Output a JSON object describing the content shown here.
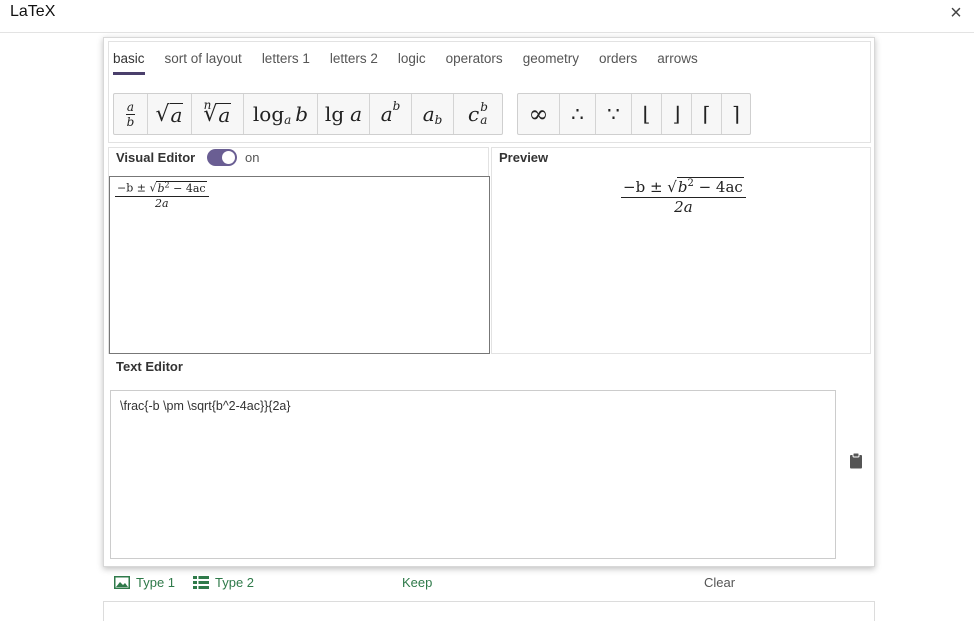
{
  "window": {
    "title": "LaTeX",
    "close_glyph": "×"
  },
  "tabs": [
    {
      "label": "basic",
      "active": true
    },
    {
      "label": "sort of layout",
      "active": false
    },
    {
      "label": "letters 1",
      "active": false
    },
    {
      "label": "letters 2",
      "active": false
    },
    {
      "label": "logic",
      "active": false
    },
    {
      "label": "operators",
      "active": false
    },
    {
      "label": "geometry",
      "active": false
    },
    {
      "label": "orders",
      "active": false
    },
    {
      "label": "arrows",
      "active": false
    }
  ],
  "symbols": {
    "group1": {
      "frac_num": "a",
      "frac_den": "b",
      "sqrt_arg": "a",
      "nroot_index": "n",
      "nroot_arg": "a",
      "log_text": "log",
      "log_base": "a",
      "log_arg": "b",
      "lg_text": "lg",
      "lg_arg": "a",
      "power_base": "a",
      "power_exp": "b",
      "subscript_base": "a",
      "subscript_sub": "b",
      "subsup_base": "c",
      "subsup_sup": "b",
      "subsup_sub": "a"
    },
    "group2": {
      "infinity": "∞",
      "therefore": "∴",
      "because": "∵",
      "lfloor": "⌊",
      "rfloor": "⌋",
      "lceil": "⌈",
      "rceil": "⌉"
    }
  },
  "visual_editor": {
    "label": "Visual Editor",
    "toggle_on": true,
    "toggle_state": "on"
  },
  "preview": {
    "label": "Preview"
  },
  "equation": {
    "num_prefix": "−b ± ",
    "sqrt_radicand_base": "b",
    "sqrt_radicand_exp": "2",
    "sqrt_radicand_rest": " − 4ac",
    "denominator": "2a"
  },
  "text_editor": {
    "label": "Text Editor",
    "value": "\\frac{-b \\pm \\sqrt{b^2-4ac}}{2a}"
  },
  "footer": {
    "type1_label": "Type 1",
    "type2_label": "Type 2",
    "keep_label": "Keep",
    "clear_label": "Clear"
  },
  "colors": {
    "accent": "#6a5e93",
    "footer_text": "#2f7a4a",
    "tab_underline": "#4a3f6b"
  }
}
